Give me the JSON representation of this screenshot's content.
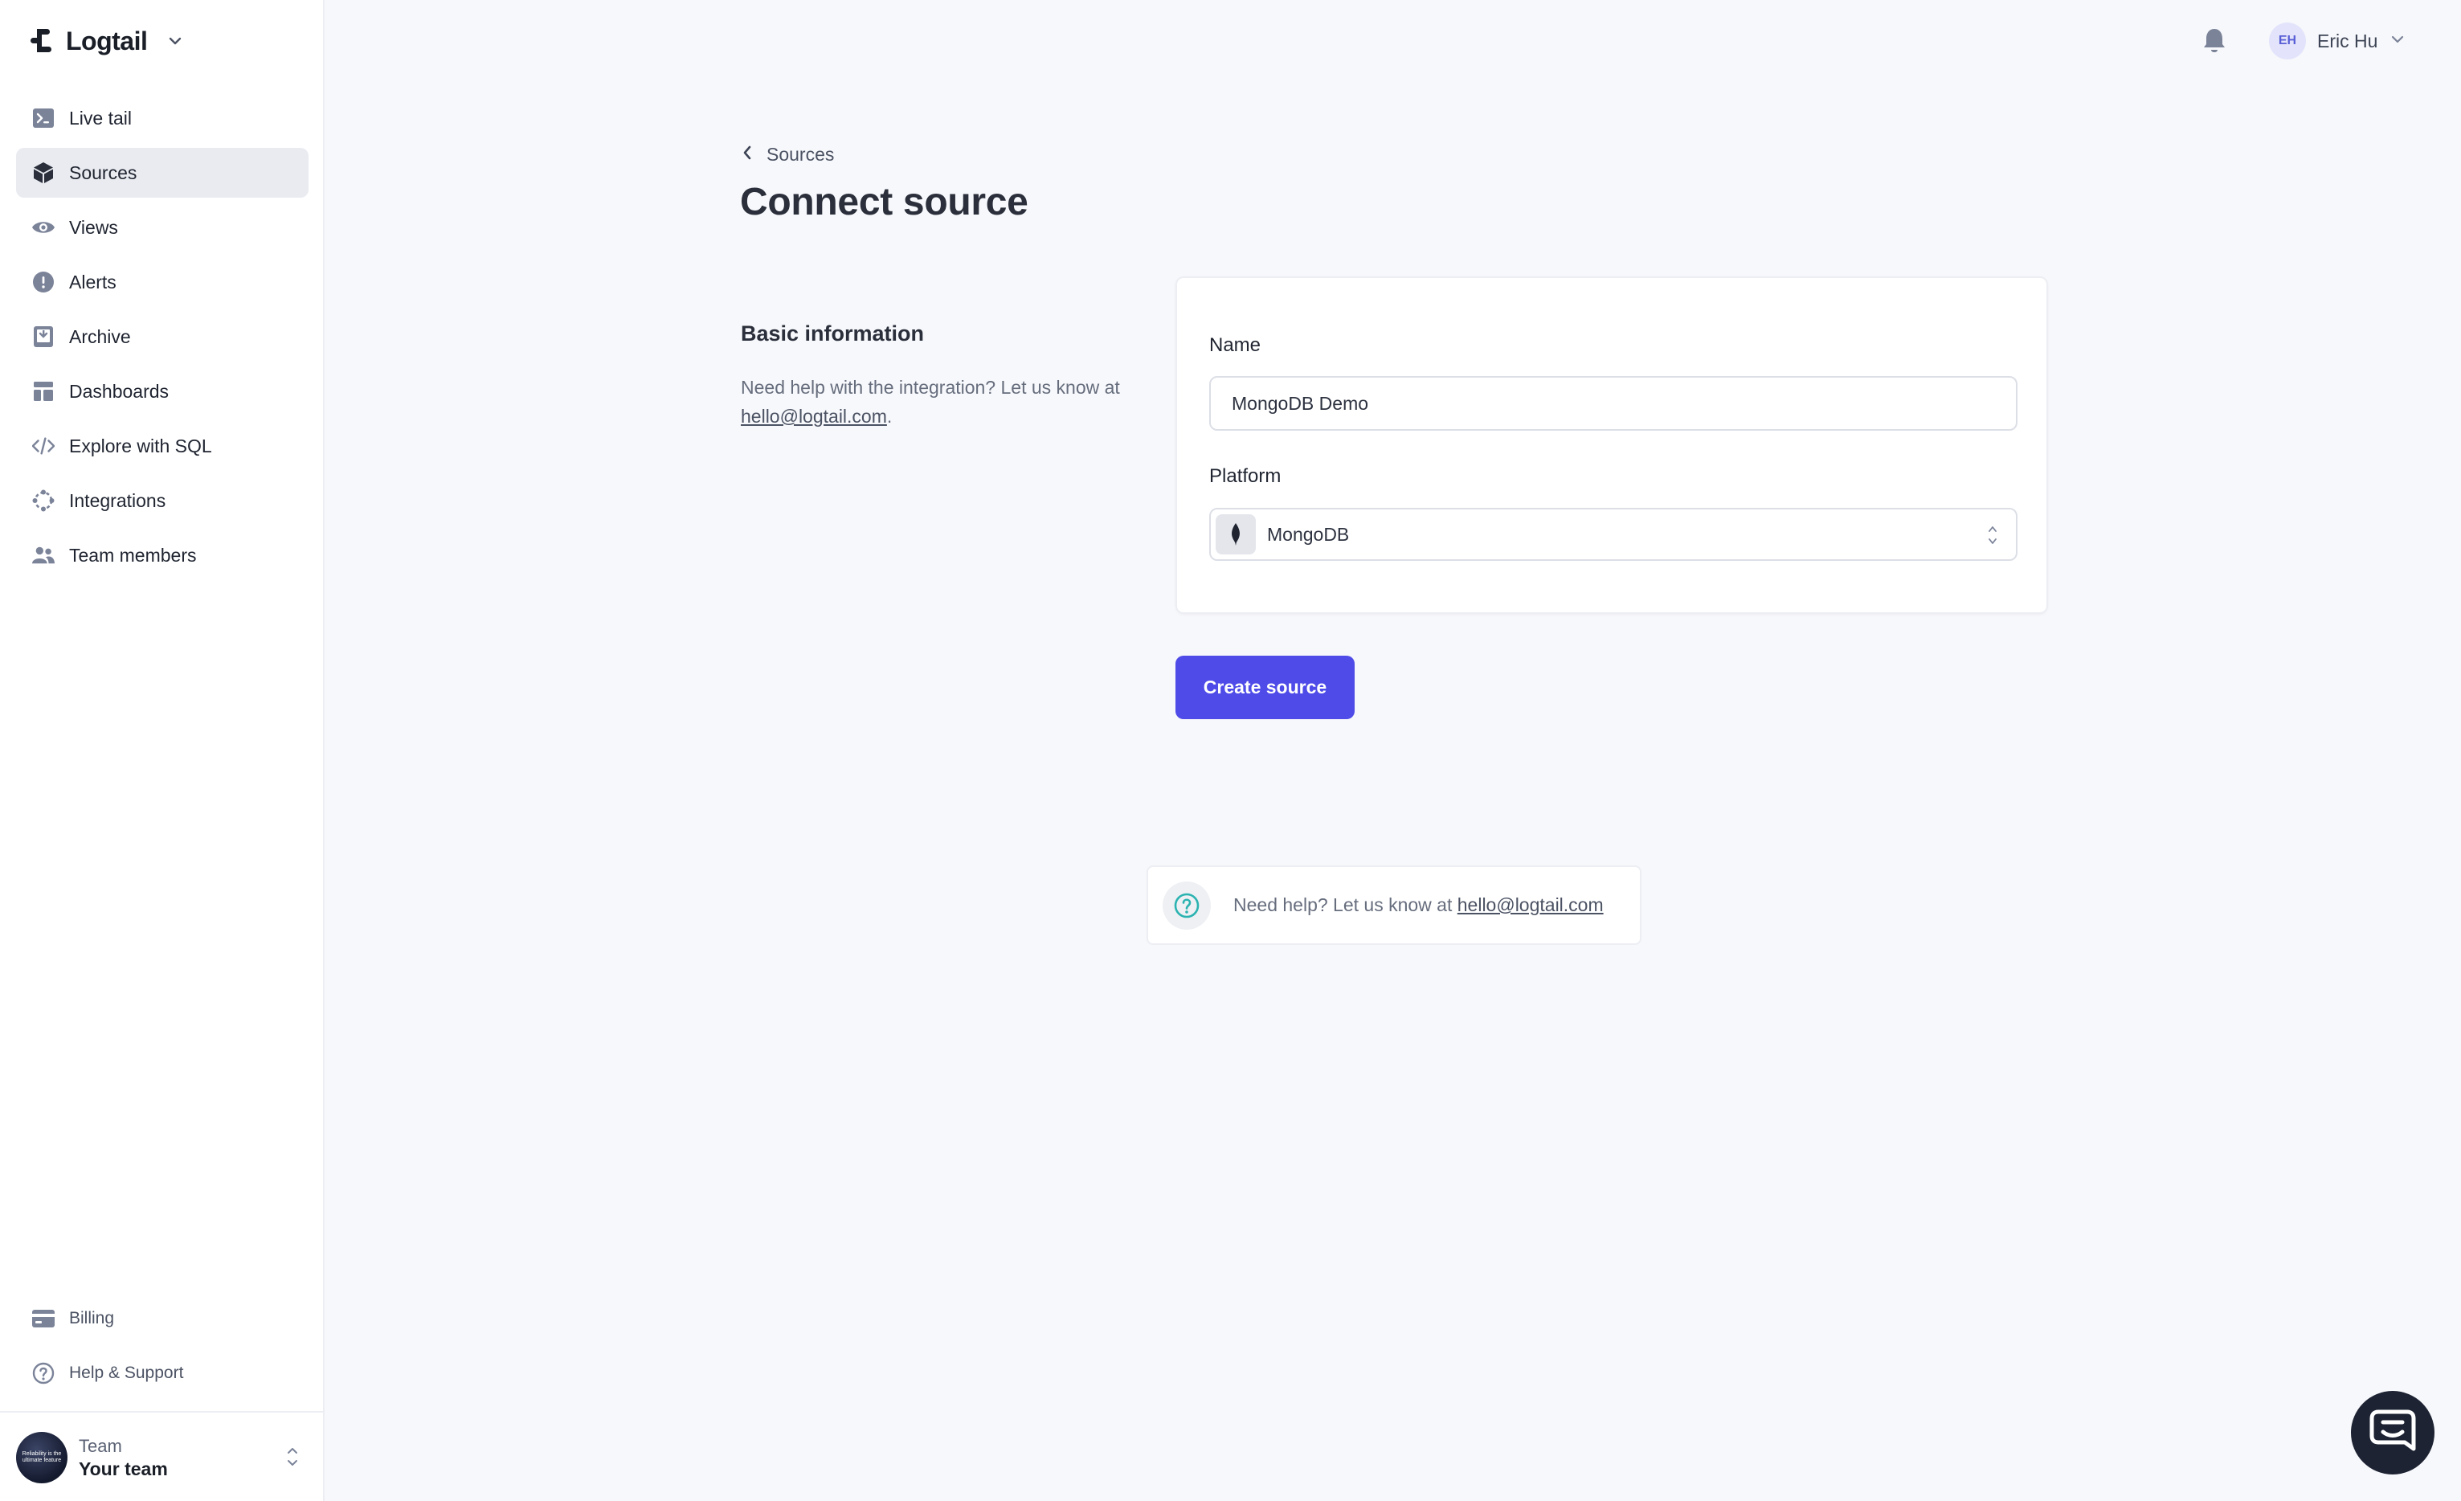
{
  "brand": {
    "name": "Logtail"
  },
  "sidebar": {
    "items": [
      {
        "label": "Live tail",
        "icon": "terminal-icon"
      },
      {
        "label": "Sources",
        "icon": "cube-icon",
        "active": true
      },
      {
        "label": "Views",
        "icon": "eye-icon"
      },
      {
        "label": "Alerts",
        "icon": "alert-icon"
      },
      {
        "label": "Archive",
        "icon": "archive-icon"
      },
      {
        "label": "Dashboards",
        "icon": "dashboard-icon"
      },
      {
        "label": "Explore with SQL",
        "icon": "code-icon"
      },
      {
        "label": "Integrations",
        "icon": "integrations-icon"
      },
      {
        "label": "Team members",
        "icon": "users-icon"
      }
    ],
    "bottom_items": [
      {
        "label": "Billing",
        "icon": "credit-card-icon"
      },
      {
        "label": "Help & Support",
        "icon": "question-icon"
      }
    ],
    "team": {
      "label": "Team",
      "name": "Your team",
      "avatar_text": "Reliability is the ultimate feature"
    }
  },
  "topbar": {
    "user": {
      "initials": "EH",
      "name": "Eric Hu"
    }
  },
  "main": {
    "back_label": "Sources",
    "title": "Connect source",
    "section": {
      "title": "Basic information",
      "help_prefix": "Need help with the integration? Let us know at ",
      "help_email": "hello@logtail.com",
      "help_suffix": "."
    },
    "form": {
      "name_label": "Name",
      "name_value": "MongoDB Demo",
      "platform_label": "Platform",
      "platform_value": "MongoDB"
    },
    "submit_label": "Create source",
    "help_box": {
      "prefix": "Need help? Let us know at ",
      "email": "hello@logtail.com"
    }
  },
  "colors": {
    "accent": "#4e4be8",
    "background": "#f7f8fb",
    "sidebar_active": "#e9ebf0"
  }
}
